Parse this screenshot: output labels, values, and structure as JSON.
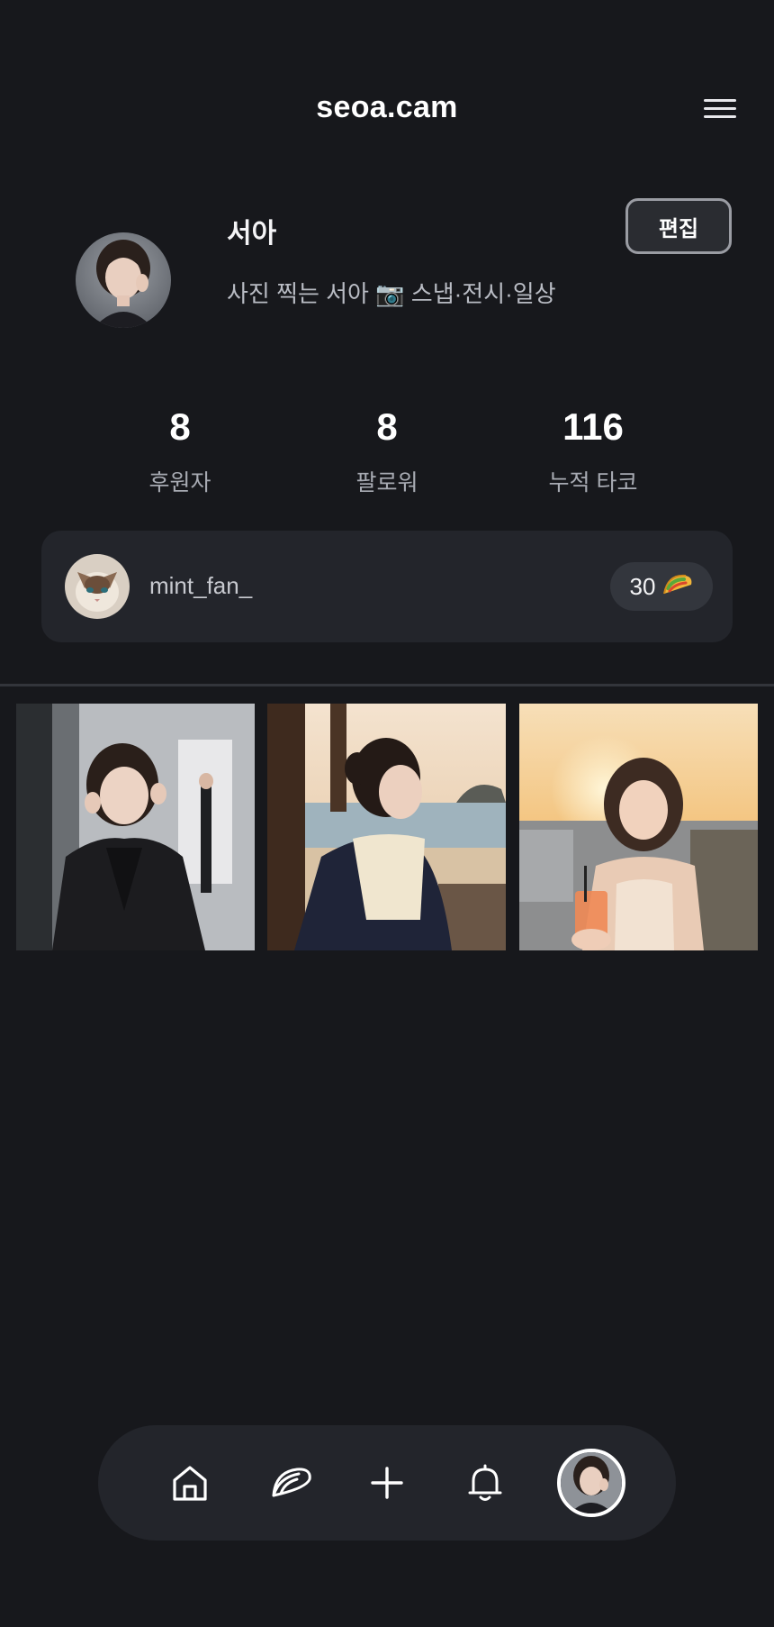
{
  "header": {
    "title": "seoa.cam",
    "menu_icon": "hamburger-menu-icon"
  },
  "profile": {
    "name": "서아",
    "bio": "사진 찍는 서아 📷 스냅·전시·일상",
    "edit_label": "편집"
  },
  "stats": [
    {
      "value": "8",
      "label": "후원자"
    },
    {
      "value": "8",
      "label": "팔로워"
    },
    {
      "value": "116",
      "label": "누적 타코"
    }
  ],
  "top_supporter": {
    "username": "mint_fan_",
    "count": "30",
    "icon": "taco-icon"
  },
  "posts": [
    {
      "name": "photo-leather-jacket"
    },
    {
      "name": "photo-beach-profile"
    },
    {
      "name": "photo-sunset-drink"
    }
  ],
  "bottom_nav": [
    "home-icon",
    "taco-icon",
    "plus-icon",
    "bell-icon",
    "profile-avatar"
  ],
  "colors": {
    "background": "#17181c",
    "card": "#23252b",
    "text": "#f2f2f4",
    "muted": "#a8abb3"
  }
}
